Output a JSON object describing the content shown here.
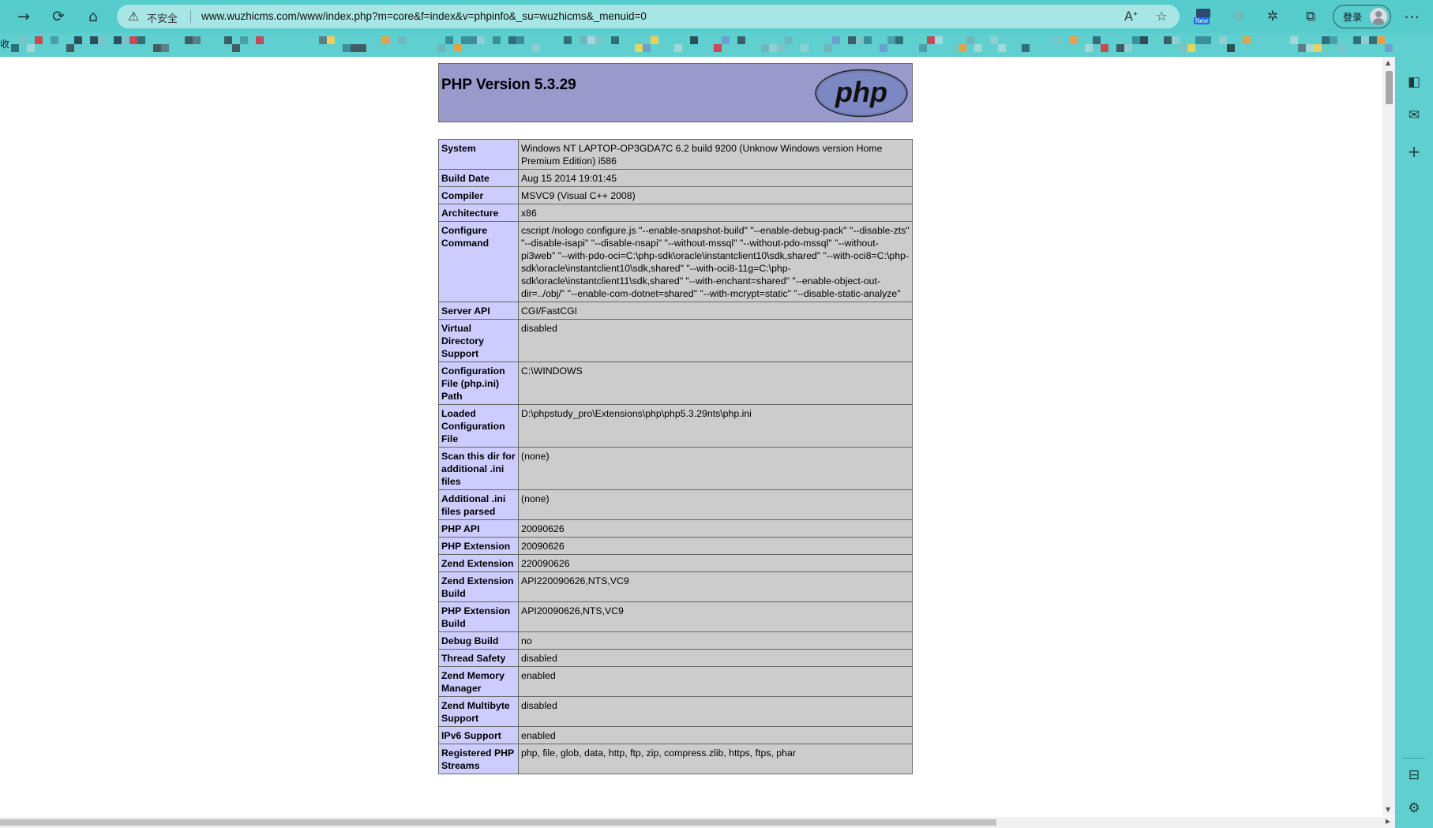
{
  "browser": {
    "url": "www.wuzhicms.com/www/index.php?m=core&f=index&v=phpinfo&_su=wuzhicms&_menuid=0",
    "security_label": "不安全",
    "new_badge": "New",
    "login_label": "登录",
    "bookmark_prefix": "收",
    "icons": {
      "forward": "forward-arrow-icon",
      "refresh": "refresh-icon",
      "home": "home-icon",
      "warning": "warning-icon",
      "read_aloud": "read-aloud-icon",
      "favorite": "add-favorite-icon",
      "extensions": "puzzle-icon",
      "collections": "collections-icon",
      "more": "more-icon"
    }
  },
  "phpinfo": {
    "title": "PHP Version 5.3.29",
    "logo_text": "php",
    "rows": [
      {
        "key": "System",
        "value": "Windows NT LAPTOP-OP3GDA7C 6.2 build 9200 (Unknow Windows version Home Premium Edition) i586"
      },
      {
        "key": "Build Date",
        "value": "Aug 15 2014 19:01:45"
      },
      {
        "key": "Compiler",
        "value": "MSVC9 (Visual C++ 2008)"
      },
      {
        "key": "Architecture",
        "value": "x86"
      },
      {
        "key": "Configure Command",
        "value": "cscript /nologo configure.js \"--enable-snapshot-build\" \"--enable-debug-pack\" \"--disable-zts\" \"--disable-isapi\" \"--disable-nsapi\" \"--without-mssql\" \"--without-pdo-mssql\" \"--without-pi3web\" \"--with-pdo-oci=C:\\php-sdk\\oracle\\instantclient10\\sdk,shared\" \"--with-oci8=C:\\php-sdk\\oracle\\instantclient10\\sdk,shared\" \"--with-oci8-11g=C:\\php-sdk\\oracle\\instantclient11\\sdk,shared\" \"--with-enchant=shared\" \"--enable-object-out-dir=../obj/\" \"--enable-com-dotnet=shared\" \"--with-mcrypt=static\" \"--disable-static-analyze\""
      },
      {
        "key": "Server API",
        "value": "CGI/FastCGI"
      },
      {
        "key": "Virtual Directory Support",
        "value": "disabled"
      },
      {
        "key": "Configuration File (php.ini) Path",
        "value": "C:\\WINDOWS"
      },
      {
        "key": "Loaded Configuration File",
        "value": "D:\\phpstudy_pro\\Extensions\\php\\php5.3.29nts\\php.ini"
      },
      {
        "key": "Scan this dir for additional .ini files",
        "value": "(none)"
      },
      {
        "key": "Additional .ini files parsed",
        "value": "(none)"
      },
      {
        "key": "PHP API",
        "value": "20090626"
      },
      {
        "key": "PHP Extension",
        "value": "20090626"
      },
      {
        "key": "Zend Extension",
        "value": "220090626"
      },
      {
        "key": "Zend Extension Build",
        "value": "API220090626,NTS,VC9"
      },
      {
        "key": "PHP Extension Build",
        "value": "API20090626,NTS,VC9"
      },
      {
        "key": "Debug Build",
        "value": "no"
      },
      {
        "key": "Thread Safety",
        "value": "disabled"
      },
      {
        "key": "Zend Memory Manager",
        "value": "enabled"
      },
      {
        "key": "Zend Multibyte Support",
        "value": "disabled"
      },
      {
        "key": "IPv6 Support",
        "value": "enabled"
      },
      {
        "key": "Registered PHP Streams",
        "value": "php, file, glob, data, http, ftp, zip, compress.zlib, https, ftps, phar"
      }
    ]
  },
  "colors": {
    "chrome": "#56cccd",
    "header_bg": "#9999cc",
    "key_bg": "#ccccff",
    "value_bg": "#cccccc"
  }
}
